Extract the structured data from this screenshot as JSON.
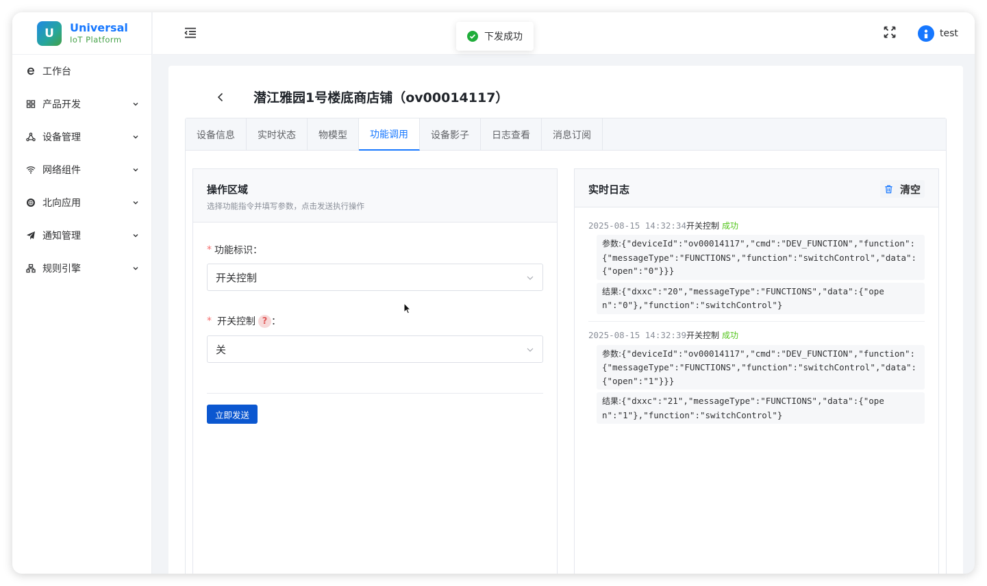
{
  "app": {
    "logo_letter": "U",
    "name": "Universal",
    "subtitle": "IoT Platform"
  },
  "sidebar": {
    "items": [
      {
        "label": "工作台",
        "icon": "ie-icon",
        "expandable": false
      },
      {
        "label": "产品开发",
        "icon": "grid-icon",
        "expandable": true
      },
      {
        "label": "设备管理",
        "icon": "nodes-icon",
        "expandable": true
      },
      {
        "label": "网络组件",
        "icon": "wifi-icon",
        "expandable": true
      },
      {
        "label": "北向应用",
        "icon": "globe-icon",
        "expandable": true
      },
      {
        "label": "通知管理",
        "icon": "send-icon",
        "expandable": true
      },
      {
        "label": "规则引擎",
        "icon": "flow-icon",
        "expandable": true
      }
    ]
  },
  "header": {
    "user": "test"
  },
  "toast": {
    "text": "下发成功",
    "color": "#1fad3a"
  },
  "page": {
    "title": "潜江雅园1号楼底商店铺（ov00014117）",
    "tabs": [
      {
        "label": "设备信息",
        "active": false
      },
      {
        "label": "实时状态",
        "active": false
      },
      {
        "label": "物模型",
        "active": false
      },
      {
        "label": "功能调用",
        "active": true
      },
      {
        "label": "设备影子",
        "active": false
      },
      {
        "label": "日志查看",
        "active": false
      },
      {
        "label": "消息订阅",
        "active": false
      }
    ]
  },
  "operation": {
    "title": "操作区域",
    "subtitle": "选择功能指令并填写参数，点击发送执行操作",
    "function_label": "功能标识：",
    "function_value": "开关控制",
    "switch_label_prefix": "开关控制",
    "switch_help": "?",
    "switch_label_suffix": "：",
    "switch_value": "关",
    "send_label": "立即发送"
  },
  "log": {
    "title": "实时日志",
    "clear_label": "清空",
    "entries": [
      {
        "time": "2025-08-15 14:32:34",
        "name": "开关控制",
        "status": "成功",
        "params_key": "参数:",
        "params": "{\"deviceId\":\"ov00014117\",\"cmd\":\"DEV_FUNCTION\",\"function\":{\"messageType\":\"FUNCTIONS\",\"function\":\"switchControl\",\"data\":{\"open\":\"0\"}}}",
        "result_key": "结果:",
        "result": "{\"dxxc\":\"20\",\"messageType\":\"FUNCTIONS\",\"data\":{\"open\":\"0\"},\"function\":\"switchControl\"}"
      },
      {
        "time": "2025-08-15 14:32:39",
        "name": "开关控制",
        "status": "成功",
        "params_key": "参数:",
        "params": "{\"deviceId\":\"ov00014117\",\"cmd\":\"DEV_FUNCTION\",\"function\":{\"messageType\":\"FUNCTIONS\",\"function\":\"switchControl\",\"data\":{\"open\":\"1\"}}}",
        "result_key": "结果:",
        "result": "{\"dxxc\":\"21\",\"messageType\":\"FUNCTIONS\",\"data\":{\"open\":\"1\"},\"function\":\"switchControl\"}"
      }
    ]
  },
  "colors": {
    "primary": "#1677ff",
    "button": "#0b57d0",
    "success": "#52c41a",
    "required": "#f56c6c"
  }
}
